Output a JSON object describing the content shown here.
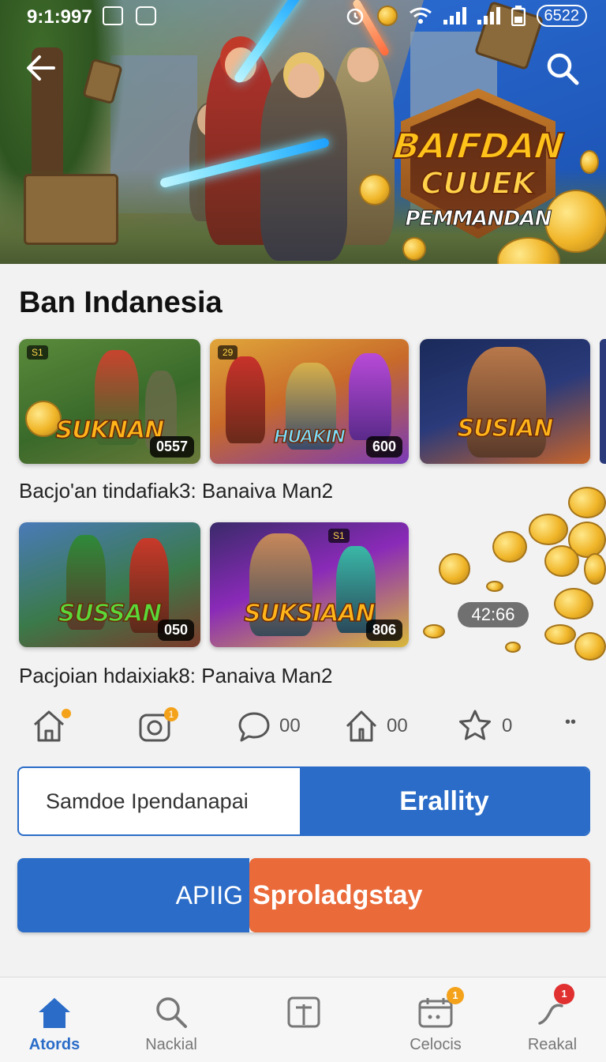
{
  "status_bar": {
    "time": "9:1:997",
    "battery": "6522"
  },
  "hero": {
    "badge_line1": "BAIFDAN",
    "badge_line2": "CUUEK",
    "badge_line3": "PEMMANDAN"
  },
  "section": {
    "title": "Ban Indanesia"
  },
  "row1": {
    "cards": [
      {
        "logo": "SUKNAN",
        "count": "0557",
        "tag": "S1"
      },
      {
        "logo": "HUAKIN",
        "count": "600",
        "tag": "29"
      },
      {
        "logo": "SUSIAN",
        "count": "",
        "tag": ""
      }
    ],
    "caption": "Bacjo'an tindafiak3: Banaiva Man2"
  },
  "row2": {
    "cards": [
      {
        "logo": "SUSSAN",
        "count": "050",
        "tag": ""
      },
      {
        "logo": "SUKSIAAN",
        "count": "806",
        "tag": "S1"
      }
    ],
    "caption": "Pacjoian hdaixiak8: Panaiva Man2",
    "timer": "42:66"
  },
  "actions": {
    "comment_count": "00",
    "share_count": "00",
    "star_count": "0",
    "more": "••"
  },
  "segment": {
    "left_label": "Samdoe Ipendanapai",
    "right_label": "Erallity"
  },
  "cta": {
    "left_label": "APIIG",
    "right_label": "Sproladgstay"
  },
  "nav": {
    "items": [
      {
        "label": "Atords",
        "icon": "home-icon"
      },
      {
        "label": "Nackial",
        "icon": "search-icon"
      },
      {
        "label": "",
        "icon": "book-icon"
      },
      {
        "label": "Celocis",
        "icon": "calendar-icon",
        "badge": "1"
      },
      {
        "label": "Reakal",
        "icon": "bell-icon",
        "badge": "1"
      }
    ]
  },
  "colors": {
    "accent_blue": "#2a6cc8",
    "accent_orange": "#ea6a3a",
    "badge_yellow": "#f4a21a",
    "badge_red": "#e03030"
  }
}
